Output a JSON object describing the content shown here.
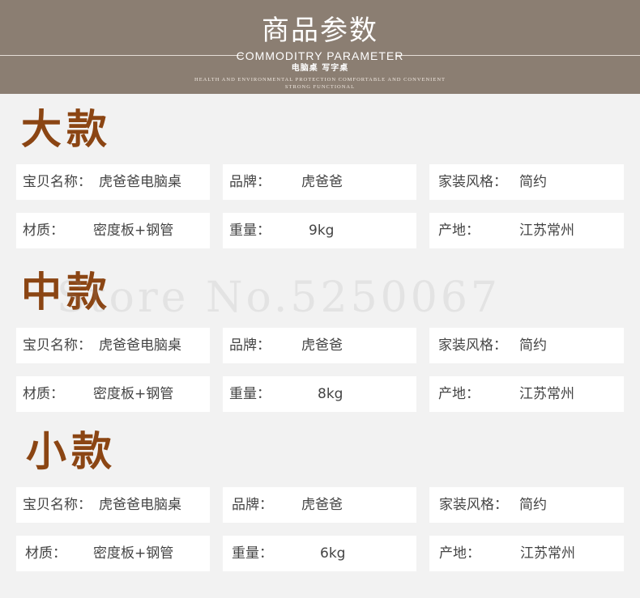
{
  "header": {
    "title": "商品参数",
    "subtitle_en": "COMMODITRY PARAMETER",
    "subtitle_cn": "电脑桌  写字桌",
    "tagline_1": "HEALTH AND ENVIRONMENTAL PROTECTION COMFORTABLE AND CONVENIENT",
    "tagline_2": "STRONG FUNCTIONAL"
  },
  "watermark": "Store No.5250067",
  "sections": [
    {
      "title": "大款",
      "name_label": "宝贝名称：",
      "name_value": "虎爸爸电脑桌",
      "brand_label": "品牌：",
      "brand_value": "虎爸爸",
      "style_label": "家装风格：",
      "style_value": "简约",
      "material_label": "材质：",
      "material_value": "密度板+钢管",
      "weight_label": "重量：",
      "weight_value": "9kg",
      "origin_label": "产地：",
      "origin_value": "江苏常州"
    },
    {
      "title": "中款",
      "name_label": "宝贝名称：",
      "name_value": "虎爸爸电脑桌",
      "brand_label": "品牌：",
      "brand_value": "虎爸爸",
      "style_label": "家装风格：",
      "style_value": "简约",
      "material_label": "材质：",
      "material_value": "密度板+钢管",
      "weight_label": "重量：",
      "weight_value": "8kg",
      "origin_label": "产地：",
      "origin_value": "江苏常州"
    },
    {
      "title": "小款",
      "name_label": "宝贝名称：",
      "name_value": "虎爸爸电脑桌",
      "brand_label": "品牌：",
      "brand_value": "虎爸爸",
      "style_label": "家装风格：",
      "style_value": "简约",
      "material_label": "材质：",
      "material_value": "密度板+钢管",
      "weight_label": "重量：",
      "weight_value": "6kg",
      "origin_label": "产地：",
      "origin_value": "江苏常州"
    }
  ],
  "colors": {
    "banner": "#8b7e72",
    "section_title": "#8b4513",
    "background": "#f2f2f2"
  }
}
